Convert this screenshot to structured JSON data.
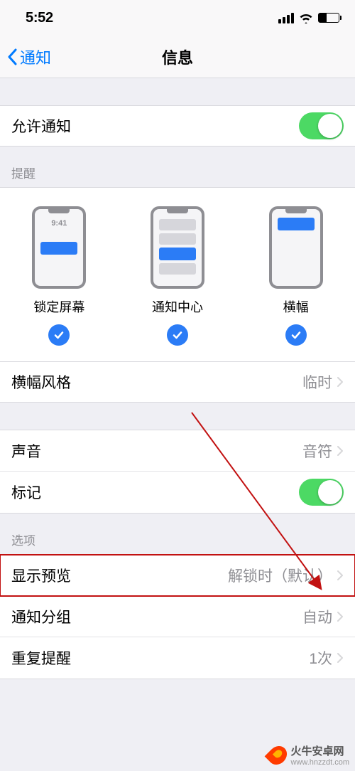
{
  "status": {
    "time": "5:52"
  },
  "nav": {
    "back": "通知",
    "title": "信息"
  },
  "allowNotifications": {
    "label": "允许通知",
    "on": true
  },
  "alertsHeader": "提醒",
  "alerts": {
    "lockScreen": {
      "label": "锁定屏幕",
      "time": "9:41",
      "checked": true
    },
    "notificationCenter": {
      "label": "通知中心",
      "checked": true
    },
    "banner": {
      "label": "横幅",
      "checked": true
    }
  },
  "bannerStyle": {
    "label": "横幅风格",
    "value": "临时"
  },
  "sound": {
    "label": "声音",
    "value": "音符"
  },
  "badges": {
    "label": "标记",
    "on": true
  },
  "optionsHeader": "选项",
  "options": {
    "showPreviews": {
      "label": "显示预览",
      "value": "解锁时（默认）"
    },
    "grouping": {
      "label": "通知分组",
      "value": "自动"
    },
    "repeat": {
      "label": "重复提醒",
      "value": "1次"
    }
  },
  "watermark": {
    "name": "火牛安卓网",
    "url": "www.hnzzdt.com"
  }
}
